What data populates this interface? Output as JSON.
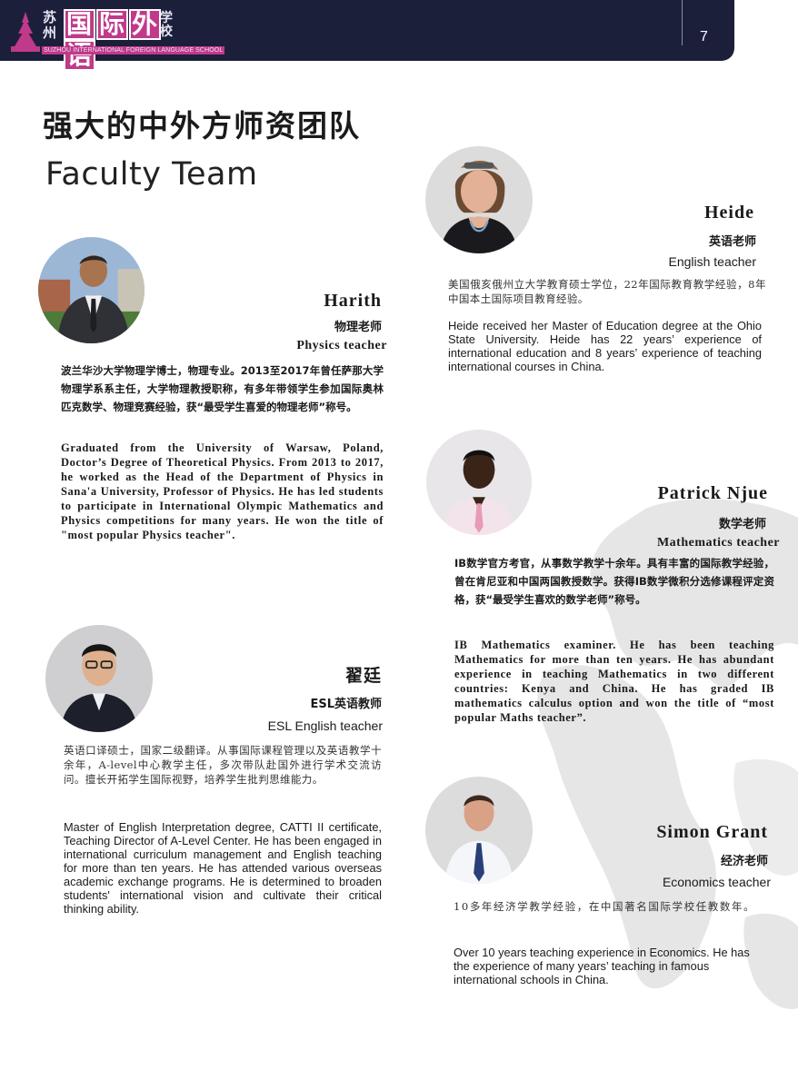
{
  "header": {
    "logo_cn_small": "苏州",
    "logo_cn": [
      "国",
      "际",
      "外",
      "语"
    ],
    "logo_cn_sub": "学校",
    "logo_en": "SUZHOU INTERNATIONAL FOREIGN LANGUAGE SCHOOL",
    "page_number": "7"
  },
  "title_cn": "强大的中外方师资团队",
  "title_en": "Faculty Team",
  "teachers": {
    "harith": {
      "name": "Harith",
      "role_cn": "物理老师",
      "role_en": "Physics teacher",
      "bio_cn": "波兰华沙大学物理学博士，物理专业。2013至2017年曾任萨那大学物理学系系主任，大学物理教授职称，有多年带领学生参加国际奥林匹克数学、物理竞赛经验，获“最受学生喜爱的物理老师”称号。",
      "bio_en": "Graduated from the University of Warsaw, Poland, Doctor’s Degree of Theoretical Physics. From 2013 to 2017, he worked as the Head of the Department of Physics in Sana'a University, Professor of Physics. He has led students to participate in International Olympic Mathematics and Physics competitions for many years. He won the title of \"most popular Physics teacher\"."
    },
    "heide": {
      "name": "Heide",
      "role_cn": "英语老师",
      "role_en": "English teacher",
      "bio_cn": "美国俄亥俄州立大学教育硕士学位，22年国际教育教学经验，8年中国本土国际项目教育经验。",
      "bio_en": "Heide received her Master of Education degree at the Ohio State University. Heide has 22 years’ experience of international education and 8 years’ experience of teaching international courses in China."
    },
    "patrick": {
      "name": "Patrick Njue",
      "role_cn": "数学老师",
      "role_en": "Mathematics teacher",
      "bio_cn": "IB数学官方考官，从事数学教学十余年。具有丰富的国际教学经验，曾在肯尼亚和中国两国教授数学。获得IB数学微积分选修课程评定资格，获“最受学生喜欢的数学老师”称号。",
      "bio_en": "IB Mathematics examiner. He has been teaching Mathematics for more than ten years. He has abundant experience in teaching Mathematics in two different countries: Kenya and China. He has graded IB mathematics calculus option and won the title of “most popular Maths teacher”."
    },
    "zhai": {
      "name": "翟廷",
      "role_cn": "ESL英语教师",
      "role_en": "ESL English teacher",
      "bio_cn": "英语口译硕士，国家二级翻译。从事国际课程管理以及英语教学十余年，A-level中心教学主任，多次带队赴国外进行学术交流访问。擅长开拓学生国际视野，培养学生批判思维能力。",
      "bio_en": "Master of English Interpretation degree, CATTI II certificate, Teaching Director of A-Level Center. He has been engaged in international curriculum management and English teaching for more than ten years. He has attended various overseas academic exchange programs. He is determined to broaden students' international vision and cultivate their critical thinking ability."
    },
    "simon": {
      "name": "Simon Grant",
      "role_cn": "经济老师",
      "role_en": "Economics teacher",
      "bio_cn": "10多年经济学教学经验，在中国著名国际学校任教数年。",
      "bio_en": "Over 10 years teaching experience in Economics. He has the experience of many years’ teaching in famous international schools in China."
    }
  },
  "colors": {
    "header_bg": "#1b1f3a",
    "logo_accent": "#c0398a"
  }
}
